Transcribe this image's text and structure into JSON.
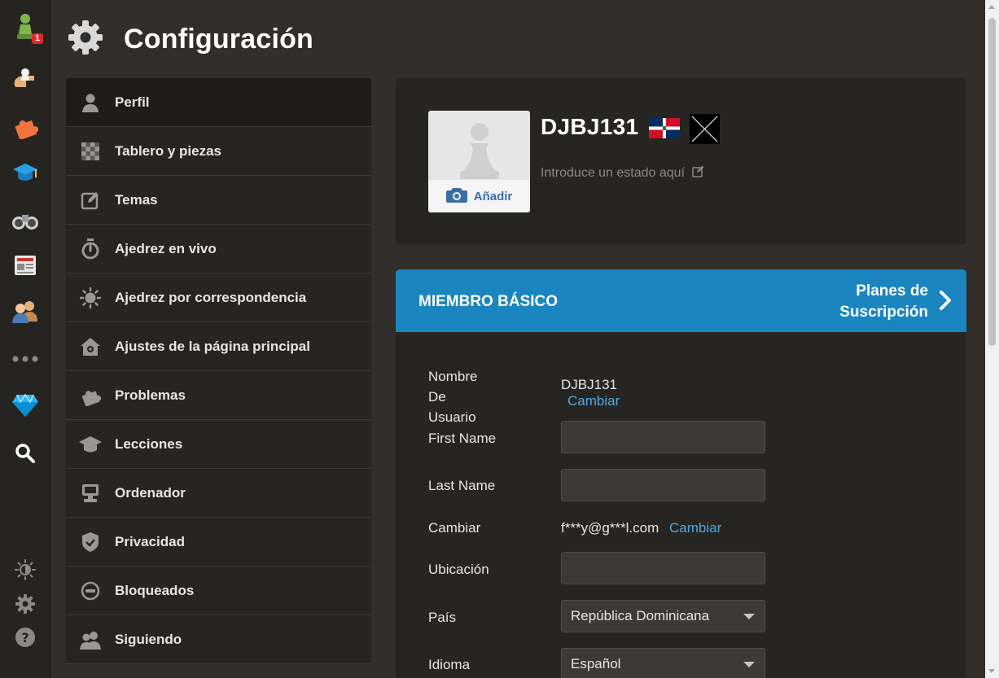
{
  "rail": {
    "notification_count": "1"
  },
  "page": {
    "title": "Configuración"
  },
  "menu": [
    {
      "label": "Perfil",
      "icon": "person-icon",
      "active": true
    },
    {
      "label": "Tablero y piezas",
      "icon": "checkerboard-icon"
    },
    {
      "label": "Temas",
      "icon": "edit-square-icon"
    },
    {
      "label": "Ajedrez en vivo",
      "icon": "stopwatch-icon"
    },
    {
      "label": "Ajedrez por correspondencia",
      "icon": "sun-icon"
    },
    {
      "label": "Ajustes de la página principal",
      "icon": "home-gear-icon"
    },
    {
      "label": "Problemas",
      "icon": "puzzle-icon"
    },
    {
      "label": "Lecciones",
      "icon": "graduation-cap-icon"
    },
    {
      "label": "Ordenador",
      "icon": "computer-icon"
    },
    {
      "label": "Privacidad",
      "icon": "shield-check-icon"
    },
    {
      "label": "Bloqueados",
      "icon": "block-icon"
    },
    {
      "label": "Siguiendo",
      "icon": "people-icon"
    }
  ],
  "profile": {
    "add_photo_label": "Añadir",
    "username": "DJBJ131",
    "status_placeholder": "Introduce un estado aquí"
  },
  "membership": {
    "label": "MIEMBRO BÁSICO",
    "plans_line1": "Planes de",
    "plans_line2": "Suscripción"
  },
  "form": {
    "username_label_line1": "Nombre De",
    "username_label_line2": "Usuario",
    "username_value": "DJBJ131",
    "change_link": "Cambiar",
    "first_name_label": "First Name",
    "first_name_value": "",
    "last_name_label": "Last Name",
    "last_name_value": "",
    "email_label": "Cambiar",
    "email_value": "f***y@g***l.com",
    "location_label": "Ubicación",
    "location_value": "",
    "country_label": "País",
    "country_value": "República Dominicana",
    "language_label": "Idioma",
    "language_value": "Español"
  },
  "colors": {
    "accent": "#1a85bf",
    "link": "#4fa8dc",
    "background": "#312e2b",
    "panel": "#272522"
  }
}
